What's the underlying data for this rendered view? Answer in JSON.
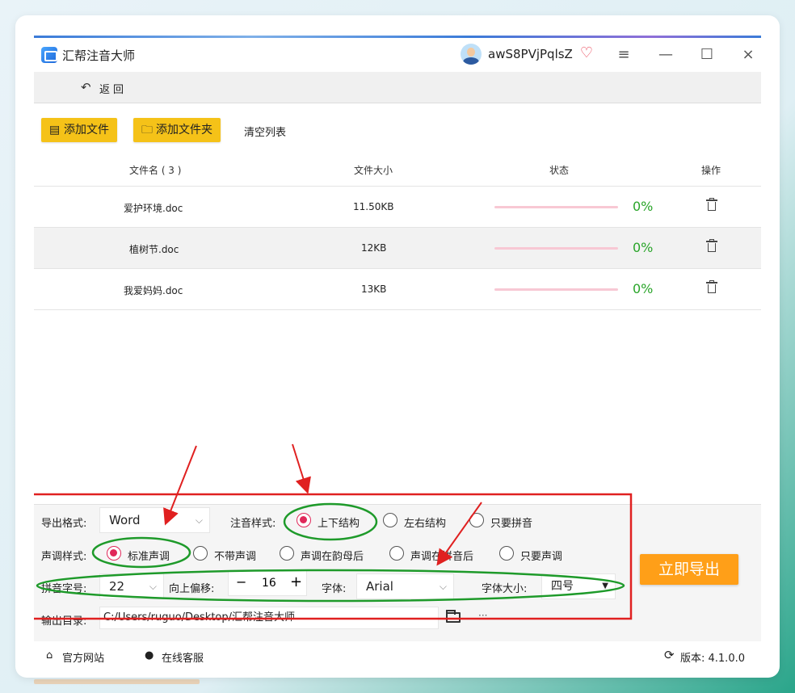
{
  "app": {
    "title": "汇帮注音大师",
    "username": "awS8PVjPqlsZ",
    "window_buttons": [
      "≡",
      "—",
      "☐",
      "×"
    ]
  },
  "nav": {
    "back_label": "返回"
  },
  "toolbar": {
    "add_file": "添加文件",
    "add_folder": "添加文件夹",
    "clear_list": "清空列表"
  },
  "table": {
    "headers": [
      "文件名 ( 3 )",
      "文件大小",
      "状态",
      "操作"
    ],
    "rows": [
      {
        "name": "爱护环境.doc",
        "size": "11.50KB",
        "progress": 0,
        "status": "0%"
      },
      {
        "name": "植树节.doc",
        "size": "12KB",
        "progress": 0,
        "status": "0%"
      },
      {
        "name": "我爱妈妈.doc",
        "size": "13KB",
        "progress": 0,
        "status": "0%"
      }
    ]
  },
  "settings": {
    "export_format_label": "导出格式:",
    "export_format_value": "Word",
    "pinyin_style_label": "注音样式:",
    "pinyin_style_options": [
      "上下结构",
      "左右结构",
      "只要拼音"
    ],
    "pinyin_style_selected": "上下结构",
    "tone_style_label": "声调样式:",
    "tone_style_options": [
      "标准声调",
      "不带声调",
      "声调在韵母后",
      "声调在拼音后",
      "只要声调"
    ],
    "tone_style_selected": "标准声调",
    "pinyin_font_size_label": "拼音字号:",
    "pinyin_font_size_value": "22",
    "offset_label": "向上偏移:",
    "offset_value": "16",
    "offset_minus": "−",
    "offset_plus": "+",
    "font_label": "字体:",
    "font_value": "Arial",
    "font_size_label": "字体大小:",
    "font_size_value": "四号",
    "output_dir_label": "输出目录:",
    "output_dir_value": "C:/Users/ruguo/Desktop/汇帮注音大师",
    "more": "···"
  },
  "export_button": "立即导出",
  "footer": {
    "website": "官方网站",
    "support": "在线客服",
    "version": "版本: 4.1.0.0"
  },
  "colors": {
    "accent_yellow": "#f5c218",
    "export_orange": "#ff9f18",
    "radio_selected": "#e0285a",
    "progress_green": "#2aa52a",
    "annotation_red": "#e02020",
    "annotation_green": "#1e9a2a"
  }
}
